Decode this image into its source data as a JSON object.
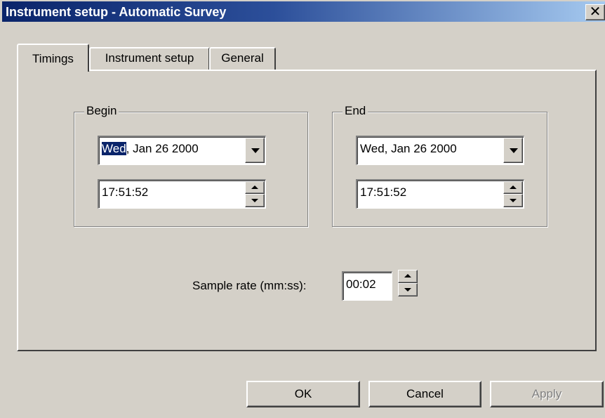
{
  "window": {
    "title": "Instrument setup - Automatic Survey",
    "close_glyph": "✕"
  },
  "tabs": [
    {
      "label": "Timings",
      "active": true
    },
    {
      "label": "Instrument setup",
      "active": false
    },
    {
      "label": "General",
      "active": false
    }
  ],
  "begin": {
    "label": "Begin",
    "date_day": "Wed",
    "date_rest": ", Jan 26 2000",
    "time": "17:51:52"
  },
  "end": {
    "label": "End",
    "date": "Wed,  Jan 26 2000",
    "time": "17:51:52"
  },
  "sample_rate": {
    "label": "Sample rate (mm:ss):",
    "value": "00:02"
  },
  "buttons": {
    "ok": "OK",
    "cancel": "Cancel",
    "apply": "Apply"
  },
  "colors": {
    "title_bar": "#0a246a",
    "face": "#d4d0c8",
    "selection": "#0a246a"
  },
  "icons": {
    "close": "close-icon",
    "dropdown": "chevron-down-icon",
    "spin_up": "spin-up-icon",
    "spin_down": "spin-down-icon"
  }
}
